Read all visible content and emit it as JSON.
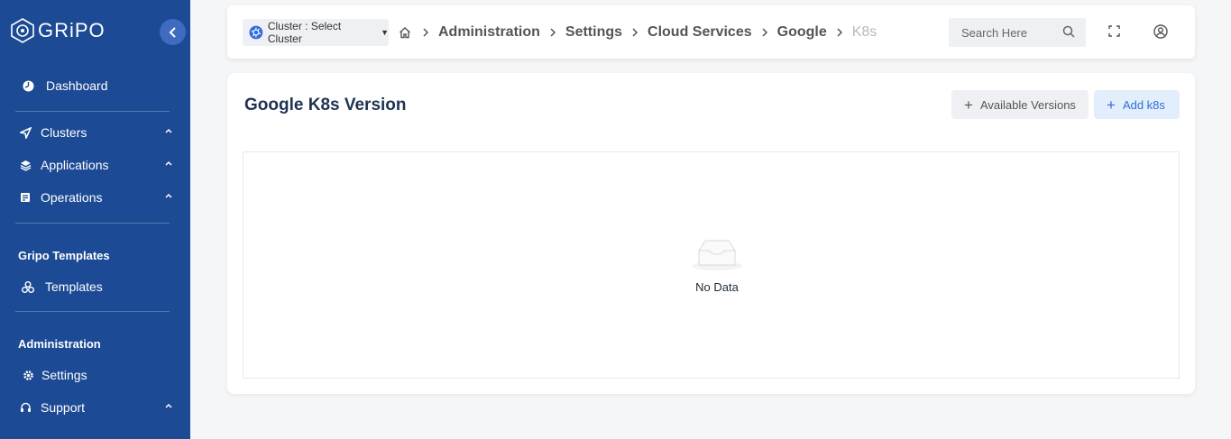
{
  "sidebar": {
    "logo_text": "GRiPO",
    "items": {
      "dashboard": "Dashboard",
      "clusters": "Clusters",
      "applications": "Applications",
      "operations": "Operations",
      "templates": "Templates",
      "settings": "Settings",
      "support": "Support"
    },
    "sections": {
      "gripo_templates": "Gripo Templates",
      "administration": "Administration"
    },
    "colors": {
      "background": "#1c4a94",
      "collapse_button": "#3f6cc0"
    }
  },
  "topbar": {
    "cluster_select_label": "Cluster : Select Cluster",
    "breadcrumb": [
      "Administration",
      "Settings",
      "Cloud Services",
      "Google"
    ],
    "breadcrumb_current": "K8s",
    "search_placeholder": "Search Here",
    "icons": [
      "home-icon",
      "search-icon",
      "fullscreen-icon",
      "user-icon",
      "kubernetes-icon"
    ]
  },
  "card": {
    "title": "Google K8s Version",
    "available_versions_label": "Available Versions",
    "add_label": "Add k8s",
    "empty_text": "No Data",
    "colors": {
      "add_button_text": "#2f6fd4",
      "title": "#1f3350"
    }
  }
}
